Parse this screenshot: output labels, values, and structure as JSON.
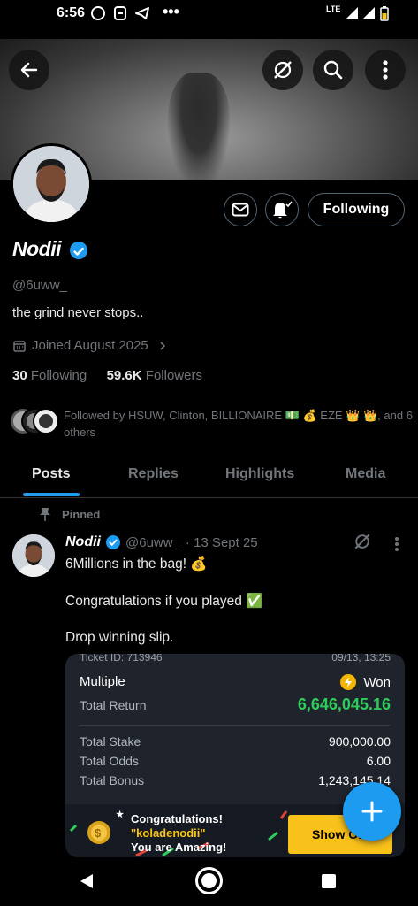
{
  "status_bar": {
    "time": "6:56",
    "more": "•••",
    "network": "LTE"
  },
  "profile": {
    "name": "Nodii",
    "handle": "@6uww_",
    "bio": "the grind never stops..",
    "joined": "Joined August 2025",
    "following_count": "30",
    "following_label": "Following",
    "followers_count": "59.6K",
    "followers_label": "Followers",
    "followed_by": "Followed by HSUW, Clinton, BILLIONAIRE 💵 💰 EZE 👑 👑, and 6 others",
    "follow_button": "Following"
  },
  "tabs": [
    "Posts",
    "Replies",
    "Highlights",
    "Media"
  ],
  "post": {
    "pinned_label": "Pinned",
    "name": "Nodii",
    "handle": "@6uww_",
    "date": "· 13 Sept 25",
    "line1": "6Millions in the bag! 💰",
    "line2": "Congratulations if you played ✅",
    "line3": "Drop winning slip."
  },
  "ticket": {
    "ticket_id": "Ticket ID: 713946",
    "date": "09/13, 13:25",
    "type": "Multiple",
    "status": "Won",
    "total_return_label": "Total Return",
    "total_return": "6,646,045.16",
    "total_stake_label": "Total Stake",
    "total_stake": "900,000.00",
    "total_odds_label": "Total Odds",
    "total_odds": "6.00",
    "total_bonus_label": "Total Bonus",
    "total_bonus": "1,243,145.14",
    "banner_line1": "Congratulations!",
    "banner_line2": "\"koladenodii\"",
    "banner_line3": "You are Amazing!",
    "show_button": "Show Of"
  },
  "colors": {
    "accent": "#1d9bf0",
    "won_green": "#2ecc5b",
    "show_yellow": "#f9c21a"
  }
}
